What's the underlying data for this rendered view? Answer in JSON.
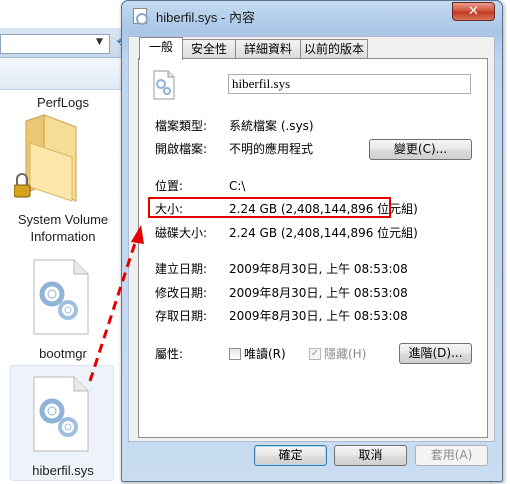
{
  "explorer": {
    "items": [
      {
        "label": "PerfLogs"
      },
      {
        "label": "System Volume\nInformation"
      },
      {
        "label": "bootmgr"
      },
      {
        "label": "hiberfil.sys"
      }
    ]
  },
  "dialog": {
    "title": "hiberfil.sys - 內容",
    "close_label": "✕",
    "tabs": [
      "一般",
      "安全性",
      "詳細資料",
      "以前的版本"
    ],
    "file_name": "hiberfil.sys",
    "rows": {
      "type_label": "檔案類型:",
      "type_value": "系統檔案 (.sys)",
      "open_label": "開啟檔案:",
      "open_value": "不明的應用程式",
      "change_button": "變更(C)...",
      "location_label": "位置:",
      "location_value": "C:\\",
      "size_label": "大小:",
      "size_value": "2.24 GB (2,408,144,896 位元組)",
      "disk_label": "磁碟大小:",
      "disk_value": "2.24 GB (2,408,144,896 位元組)",
      "created_label": "建立日期:",
      "created_value": "2009年8月30日, 上午 08:53:08",
      "modified_label": "修改日期:",
      "modified_value": "2009年8月30日, 上午 08:53:08",
      "accessed_label": "存取日期:",
      "accessed_value": "2009年8月30日, 上午 08:53:08",
      "attr_label": "屬性:",
      "readonly_label": "唯讀(R)",
      "hidden_label": "隱藏(H)",
      "advanced_button": "進階(D)..."
    },
    "buttons": {
      "ok": "確定",
      "cancel": "取消",
      "apply": "套用(A)"
    }
  },
  "colors": {
    "highlight": "#e30000",
    "title_bar": "#a9c6e6"
  }
}
